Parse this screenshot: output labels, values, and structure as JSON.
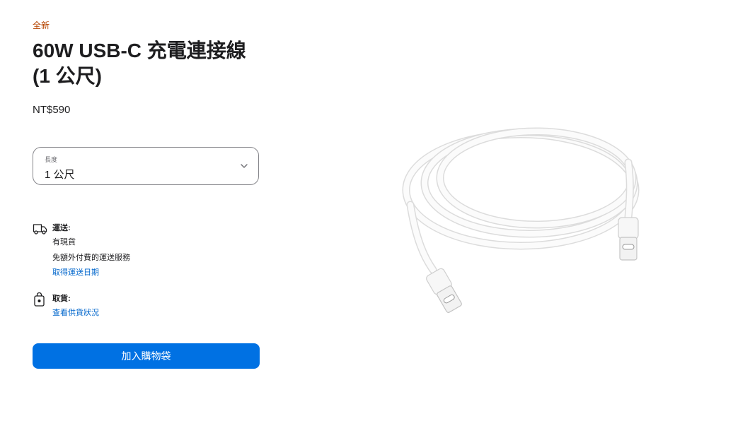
{
  "product": {
    "badge": "全新",
    "title": "60W USB-C 充電連接線 (1 公尺)",
    "price": "NT$590"
  },
  "length_select": {
    "label": "長度",
    "value": "1 公尺"
  },
  "delivery": {
    "icon": "delivery-truck-icon",
    "heading": "運送:",
    "lines": [
      "有現貨",
      "免額外付費的運送服務"
    ],
    "link": "取得運送日期"
  },
  "pickup": {
    "icon": "shopping-bag-icon",
    "heading": "取貨:",
    "link": "查看供貨狀況"
  },
  "cta": {
    "label": "加入購物袋",
    "color": "#0071e3"
  },
  "colors": {
    "badge": "#b64400",
    "link": "#0066cc"
  },
  "image": {
    "icon": "usb-c-cable-image"
  }
}
